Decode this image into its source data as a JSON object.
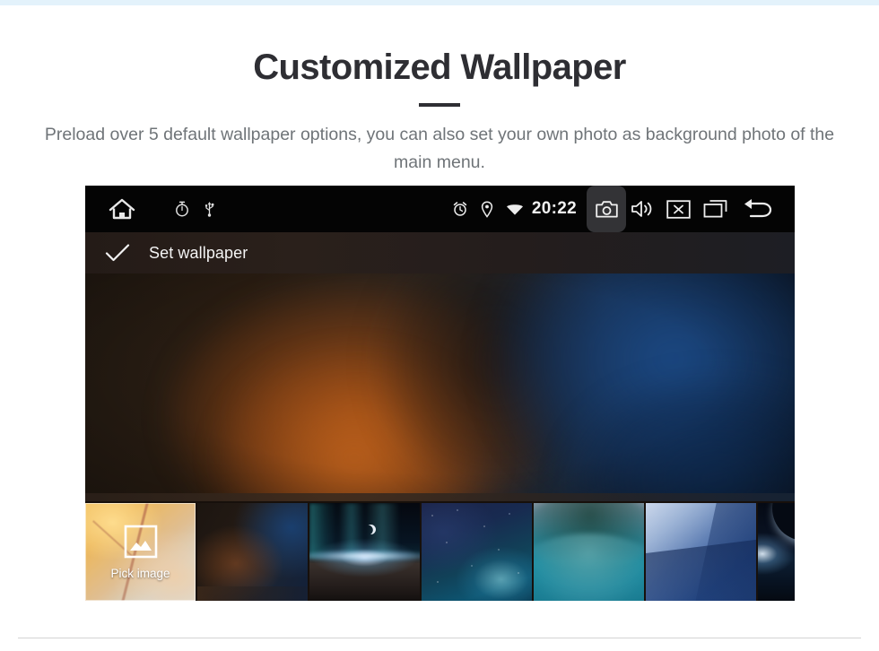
{
  "page": {
    "title": "Customized Wallpaper",
    "subtitle": "Preload over 5 default wallpaper options, you can also set your own photo as background photo of the main menu.",
    "accent_color": "#2e2e33",
    "top_band_color": "#e3f2fb",
    "divider_color": "#d3d3d3"
  },
  "device": {
    "status_bar": {
      "background": "#040404",
      "left_icons": [
        {
          "name": "home-icon",
          "label": "Home"
        },
        {
          "name": "timer-icon",
          "label": "Timer"
        },
        {
          "name": "usb-icon",
          "label": "USB"
        }
      ],
      "right_icons": [
        {
          "name": "alarm-icon",
          "label": "Alarm"
        },
        {
          "name": "location-icon",
          "label": "Location"
        },
        {
          "name": "wifi-icon",
          "label": "Wi-Fi"
        }
      ],
      "clock": "20:22",
      "camera_button": {
        "name": "camera-icon",
        "label": "Screenshot",
        "active": true,
        "highlight_color": "#333336"
      },
      "trailing_icons": [
        {
          "name": "volume-icon",
          "label": "Volume"
        },
        {
          "name": "close-box-icon",
          "label": "Close"
        },
        {
          "name": "recents-icon",
          "label": "Recent apps"
        },
        {
          "name": "back-icon",
          "label": "Back"
        }
      ]
    },
    "action_bar": {
      "confirm_icon": "check-icon",
      "title": "Set wallpaper"
    },
    "preview": {
      "name": "wallpaper-preview",
      "description": "Blurred bokeh wallpaper, warm orange left and deep blue right"
    },
    "thumbnails": [
      {
        "id": "pick-image",
        "label": "Pick image",
        "icon": "picture-icon",
        "selected": true,
        "description": "Autumn leaves background with picture frame icon"
      },
      {
        "id": "wallpaper-current",
        "label": "",
        "selected": false,
        "description": "Blurred warm and blue bokeh"
      },
      {
        "id": "wallpaper-earth-moon",
        "label": "",
        "selected": false,
        "description": "Earth horizon with crescent moon and aurora"
      },
      {
        "id": "wallpaper-nebula",
        "label": "",
        "selected": false,
        "description": "Blue starry nebula"
      },
      {
        "id": "wallpaper-wave",
        "label": "",
        "selected": false,
        "description": "Teal and pink wave arc"
      },
      {
        "id": "wallpaper-geometric",
        "label": "",
        "selected": false,
        "description": "Blue geometric gradient facets"
      },
      {
        "id": "wallpaper-eclipse",
        "label": "",
        "selected": false,
        "description": "Planet eclipse with bright horizon glow"
      }
    ]
  }
}
